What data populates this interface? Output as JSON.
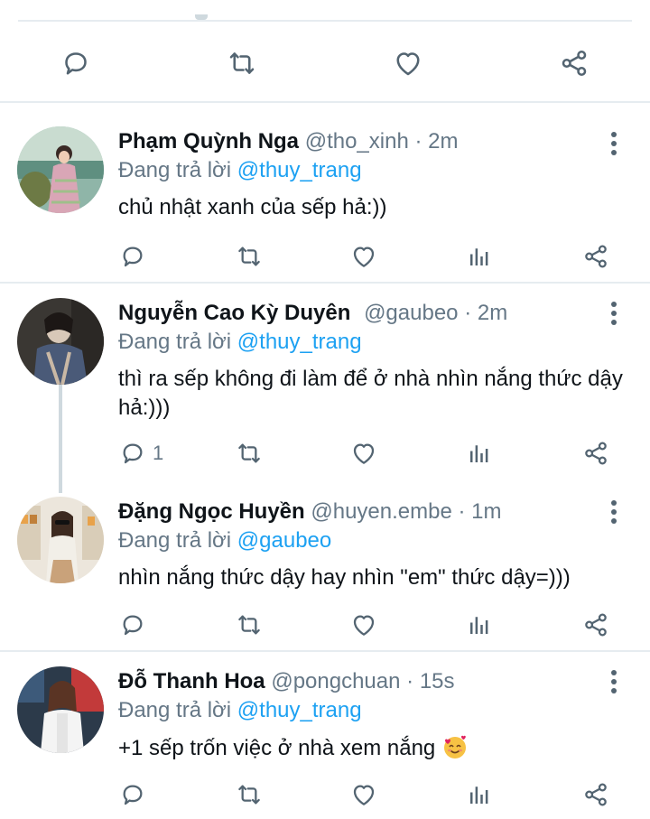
{
  "colors": {
    "accent": "#1da1f2",
    "muted": "#657786",
    "icon": "#536471",
    "divider": "#e6ecf0",
    "emoji_face": "#f7c244",
    "emoji_heart": "#e0245e"
  },
  "icons": {
    "reply": "reply-icon",
    "retweet": "retweet-icon",
    "like": "heart-icon",
    "analytics": "analytics-icon",
    "share": "share-icon",
    "more": "more-icon"
  },
  "tweets": [
    {
      "name": "Phạm Quỳnh Nga",
      "handle": "@tho_xinh",
      "separator": "·",
      "time": "2m",
      "reply_prefix": "Đang trả lời",
      "reply_to": "@thuy_trang",
      "text": "chủ nhật xanh của sếp hả:))",
      "reply_count": ""
    },
    {
      "name": "Nguyễn Cao Kỳ Duyên",
      "handle": "@gaubeo",
      "separator": "·",
      "time": "2m",
      "reply_prefix": "Đang trả lời",
      "reply_to": "@thuy_trang",
      "text": "thì ra sếp không đi làm để ở nhà nhìn nắng thức dậy hả:)))",
      "reply_count": "1"
    },
    {
      "name": "Đặng Ngọc Huyền",
      "handle": "@huyen.embe",
      "separator": "·",
      "time": "1m",
      "reply_prefix": "Đang trả lời",
      "reply_to": "@gaubeo",
      "text": "nhìn nắng thức dậy hay nhìn \"em\" thức dậy=)))",
      "reply_count": ""
    },
    {
      "name": "Đỗ Thanh Hoa",
      "handle": "@pongchuan",
      "separator": "·",
      "time": "15s",
      "reply_prefix": "Đang trả lời",
      "reply_to": "@thuy_trang",
      "text": "+1 sếp trốn việc ở nhà xem nắng",
      "emoji": "smiling-face-with-hearts",
      "reply_count": ""
    }
  ]
}
